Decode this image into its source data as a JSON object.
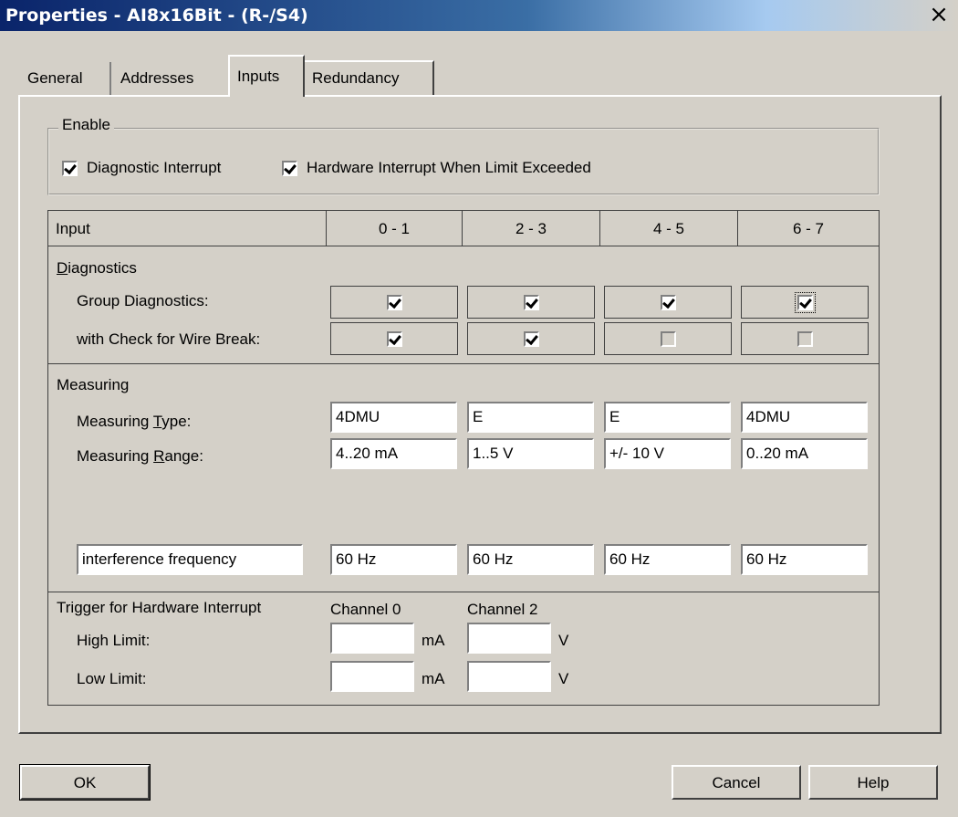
{
  "window": {
    "title": "Properties - AI8x16Bit - (R-/S4)",
    "close_glyph": "×"
  },
  "tabs": [
    {
      "label": "General",
      "active": false
    },
    {
      "label": "Addresses",
      "active": false
    },
    {
      "label": "Inputs",
      "active": true
    },
    {
      "label": "Redundancy",
      "active": false
    }
  ],
  "enable": {
    "group_label": "Enable",
    "diagnostic_interrupt": {
      "label": "Diagnostic Interrupt",
      "checked": true
    },
    "hardware_interrupt": {
      "label": "Hardware Interrupt When Limit Exceeded",
      "checked": true
    }
  },
  "table": {
    "header": {
      "input_label": "Input",
      "columns": [
        "0 - 1",
        "2 - 3",
        "4 - 5",
        "6 - 7"
      ]
    },
    "diagnostics": {
      "section_label": "Diagnostics",
      "group_diagnostics": {
        "label": "Group Diagnostics:",
        "checked": [
          true,
          true,
          true,
          true
        ]
      },
      "wire_break": {
        "label": "with Check for Wire Break:",
        "checked": [
          true,
          true,
          false,
          false
        ],
        "enabled": [
          true,
          true,
          false,
          false
        ]
      }
    },
    "measuring": {
      "section_label": "Measuring",
      "type": {
        "label": "Measuring Type:",
        "values": [
          "4DMU",
          "E",
          "E",
          "4DMU"
        ]
      },
      "range": {
        "label": "Measuring Range:",
        "values": [
          "4..20 mA",
          "1..5 V",
          "+/- 10 V",
          "0..20 mA"
        ]
      },
      "interference": {
        "label": "interference frequency",
        "values": [
          "60 Hz",
          "60 Hz",
          "60 Hz",
          "60 Hz"
        ]
      }
    },
    "trigger": {
      "section_label": "Trigger for Hardware Interrupt",
      "channel0_label": "Channel 0",
      "channel2_label": "Channel 2",
      "high_limit": {
        "label": "High Limit:",
        "ch0_value": "",
        "ch0_unit": "mA",
        "ch2_value": "",
        "ch2_unit": "V"
      },
      "low_limit": {
        "label": "Low Limit:",
        "ch0_value": "",
        "ch0_unit": "mA",
        "ch2_value": "",
        "ch2_unit": "V"
      }
    }
  },
  "buttons": {
    "ok": "OK",
    "cancel": "Cancel",
    "help": "Help"
  }
}
